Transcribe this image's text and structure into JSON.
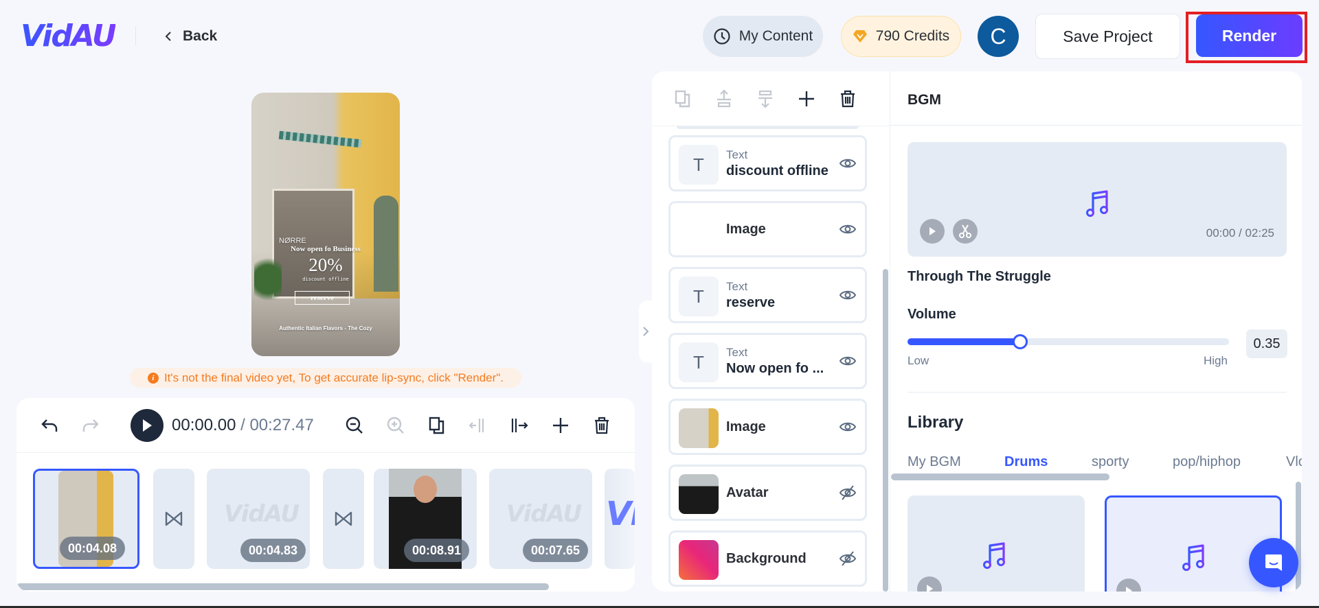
{
  "header": {
    "logo": "VidAU",
    "back_label": "Back",
    "my_content_label": "My Content",
    "credits_label": "790 Credits",
    "avatar_initial": "C",
    "save_label": "Save Project",
    "render_label": "Render"
  },
  "preview": {
    "brand": "NØRRE",
    "line1": "Now open fo Business",
    "line2": "20%",
    "line3": "discount offline",
    "button": "reserve",
    "footer": "Authentic Italian Flavors - The Cozy"
  },
  "warning": {
    "icon": "i",
    "text": "It's not the final video yet, To get accurate lip-sync, click \"Render\"."
  },
  "timeline": {
    "current_time": "00:00.00",
    "separator": " / ",
    "total_time": "00:27.47",
    "clips": [
      {
        "type": "image",
        "duration": "00:04.08",
        "selected": true
      },
      {
        "type": "transition"
      },
      {
        "type": "placeholder",
        "watermark": "VidAU",
        "duration": "00:04.83"
      },
      {
        "type": "transition"
      },
      {
        "type": "avatar",
        "duration": "00:08.91"
      },
      {
        "type": "placeholder",
        "watermark": "VidAU",
        "duration": "00:07.65"
      },
      {
        "type": "partial",
        "watermark": "Vi"
      }
    ]
  },
  "layers": {
    "items": [
      {
        "kind": "Text",
        "name": "discount offline",
        "thumb": "T",
        "visible": true
      },
      {
        "kind": "",
        "name": "Image",
        "thumb": "",
        "visible": true
      },
      {
        "kind": "Text",
        "name": "reserve",
        "thumb": "T",
        "visible": true
      },
      {
        "kind": "Text",
        "name": "Now open fo ...",
        "thumb": "T",
        "visible": true
      },
      {
        "kind": "",
        "name": "Image",
        "thumb": "image",
        "visible": true
      },
      {
        "kind": "",
        "name": "Avatar",
        "thumb": "avatar",
        "visible": false
      },
      {
        "kind": "",
        "name": "Background",
        "thumb": "gradient",
        "visible": false
      }
    ]
  },
  "bgm": {
    "title": "BGM",
    "time": "00:00 / 02:25",
    "track": "Through The Struggle",
    "volume_label": "Volume",
    "volume_value": "0.35",
    "volume_fraction": 0.35,
    "low_label": "Low",
    "high_label": "High",
    "library_title": "Library",
    "tabs": [
      "My BGM",
      "Drums",
      "sporty",
      "pop/hiphop",
      "Vlo"
    ],
    "active_tab": "Drums"
  },
  "colors": {
    "accent": "#3657ff",
    "accent_purple": "#6b3cff",
    "warning": "#f47b20",
    "annotation": "#e31e24"
  }
}
